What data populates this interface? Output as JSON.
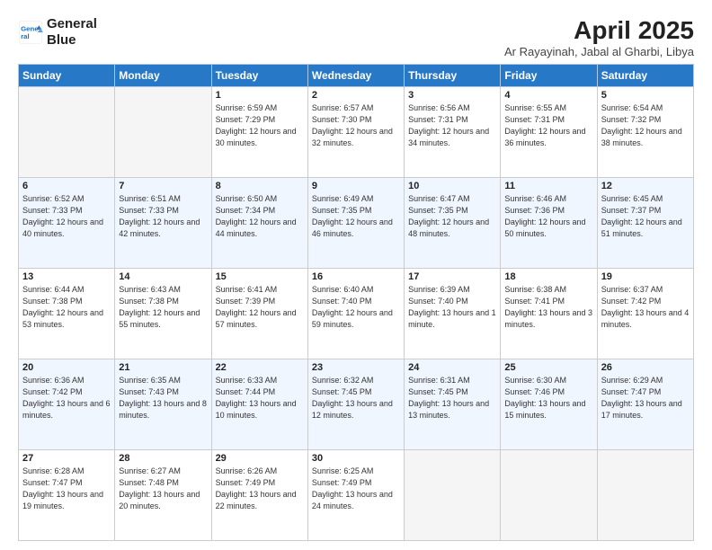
{
  "header": {
    "logo_line1": "General",
    "logo_line2": "Blue",
    "title": "April 2025",
    "subtitle": "Ar Rayayinah, Jabal al Gharbi, Libya"
  },
  "days_of_week": [
    "Sunday",
    "Monday",
    "Tuesday",
    "Wednesday",
    "Thursday",
    "Friday",
    "Saturday"
  ],
  "weeks": [
    [
      {
        "day": "",
        "info": ""
      },
      {
        "day": "",
        "info": ""
      },
      {
        "day": "1",
        "info": "Sunrise: 6:59 AM\nSunset: 7:29 PM\nDaylight: 12 hours and 30 minutes."
      },
      {
        "day": "2",
        "info": "Sunrise: 6:57 AM\nSunset: 7:30 PM\nDaylight: 12 hours and 32 minutes."
      },
      {
        "day": "3",
        "info": "Sunrise: 6:56 AM\nSunset: 7:31 PM\nDaylight: 12 hours and 34 minutes."
      },
      {
        "day": "4",
        "info": "Sunrise: 6:55 AM\nSunset: 7:31 PM\nDaylight: 12 hours and 36 minutes."
      },
      {
        "day": "5",
        "info": "Sunrise: 6:54 AM\nSunset: 7:32 PM\nDaylight: 12 hours and 38 minutes."
      }
    ],
    [
      {
        "day": "6",
        "info": "Sunrise: 6:52 AM\nSunset: 7:33 PM\nDaylight: 12 hours and 40 minutes."
      },
      {
        "day": "7",
        "info": "Sunrise: 6:51 AM\nSunset: 7:33 PM\nDaylight: 12 hours and 42 minutes."
      },
      {
        "day": "8",
        "info": "Sunrise: 6:50 AM\nSunset: 7:34 PM\nDaylight: 12 hours and 44 minutes."
      },
      {
        "day": "9",
        "info": "Sunrise: 6:49 AM\nSunset: 7:35 PM\nDaylight: 12 hours and 46 minutes."
      },
      {
        "day": "10",
        "info": "Sunrise: 6:47 AM\nSunset: 7:35 PM\nDaylight: 12 hours and 48 minutes."
      },
      {
        "day": "11",
        "info": "Sunrise: 6:46 AM\nSunset: 7:36 PM\nDaylight: 12 hours and 50 minutes."
      },
      {
        "day": "12",
        "info": "Sunrise: 6:45 AM\nSunset: 7:37 PM\nDaylight: 12 hours and 51 minutes."
      }
    ],
    [
      {
        "day": "13",
        "info": "Sunrise: 6:44 AM\nSunset: 7:38 PM\nDaylight: 12 hours and 53 minutes."
      },
      {
        "day": "14",
        "info": "Sunrise: 6:43 AM\nSunset: 7:38 PM\nDaylight: 12 hours and 55 minutes."
      },
      {
        "day": "15",
        "info": "Sunrise: 6:41 AM\nSunset: 7:39 PM\nDaylight: 12 hours and 57 minutes."
      },
      {
        "day": "16",
        "info": "Sunrise: 6:40 AM\nSunset: 7:40 PM\nDaylight: 12 hours and 59 minutes."
      },
      {
        "day": "17",
        "info": "Sunrise: 6:39 AM\nSunset: 7:40 PM\nDaylight: 13 hours and 1 minute."
      },
      {
        "day": "18",
        "info": "Sunrise: 6:38 AM\nSunset: 7:41 PM\nDaylight: 13 hours and 3 minutes."
      },
      {
        "day": "19",
        "info": "Sunrise: 6:37 AM\nSunset: 7:42 PM\nDaylight: 13 hours and 4 minutes."
      }
    ],
    [
      {
        "day": "20",
        "info": "Sunrise: 6:36 AM\nSunset: 7:42 PM\nDaylight: 13 hours and 6 minutes."
      },
      {
        "day": "21",
        "info": "Sunrise: 6:35 AM\nSunset: 7:43 PM\nDaylight: 13 hours and 8 minutes."
      },
      {
        "day": "22",
        "info": "Sunrise: 6:33 AM\nSunset: 7:44 PM\nDaylight: 13 hours and 10 minutes."
      },
      {
        "day": "23",
        "info": "Sunrise: 6:32 AM\nSunset: 7:45 PM\nDaylight: 13 hours and 12 minutes."
      },
      {
        "day": "24",
        "info": "Sunrise: 6:31 AM\nSunset: 7:45 PM\nDaylight: 13 hours and 13 minutes."
      },
      {
        "day": "25",
        "info": "Sunrise: 6:30 AM\nSunset: 7:46 PM\nDaylight: 13 hours and 15 minutes."
      },
      {
        "day": "26",
        "info": "Sunrise: 6:29 AM\nSunset: 7:47 PM\nDaylight: 13 hours and 17 minutes."
      }
    ],
    [
      {
        "day": "27",
        "info": "Sunrise: 6:28 AM\nSunset: 7:47 PM\nDaylight: 13 hours and 19 minutes."
      },
      {
        "day": "28",
        "info": "Sunrise: 6:27 AM\nSunset: 7:48 PM\nDaylight: 13 hours and 20 minutes."
      },
      {
        "day": "29",
        "info": "Sunrise: 6:26 AM\nSunset: 7:49 PM\nDaylight: 13 hours and 22 minutes."
      },
      {
        "day": "30",
        "info": "Sunrise: 6:25 AM\nSunset: 7:49 PM\nDaylight: 13 hours and 24 minutes."
      },
      {
        "day": "",
        "info": ""
      },
      {
        "day": "",
        "info": ""
      },
      {
        "day": "",
        "info": ""
      }
    ]
  ]
}
